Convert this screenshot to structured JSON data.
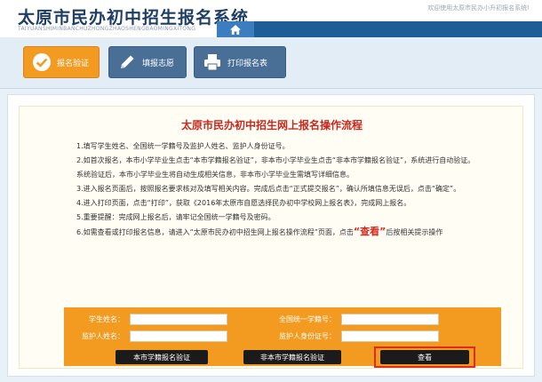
{
  "header": {
    "title": "太原市民办初中招生报名系统",
    "subtitle": "TAIYUANSHIMINBANCHUZHONGZHAOSHENGBAOMINGXITONG",
    "welcome": "欢迎使用太原市民办小升初报名系统!",
    "home_icon": "home-icon"
  },
  "toolbar": {
    "verify_label": "报名验证",
    "view_label": "填报志愿",
    "print_label": "打印报名表"
  },
  "content": {
    "title": "太原市民办初中招生网上报名操作流程",
    "steps": [
      "1.填写学生姓名、全国统一学籍号及监护人姓名、监护人身份证号。",
      "2.如首次报名，本市小学毕业生点击“本市学籍报名验证”，非本市小学毕业生点击“非本市学籍报名验证”，系统进行自动验证。",
      "系统验证后，本市小学毕业生将自动生成相关信息，非本市小学毕业生需填写详细信息。",
      "3.进入报名页面后，按照报名要求核对及填写相关内容。完成后点击“正式提交报名”，确认所填信息无误后，点击“确定”。",
      "4.进入打印页面，点击“打印”，获取《2016年太原市自愿选择民办初中学校网上报名表》，完成网上报名。",
      "5.重要提醒：完成网上报名后，请牢记全国统一学籍号及密码。"
    ],
    "step6_before": "6.如需查看或打印报名信息，请进入“太原市民办初中招生网上报名操作流程”页面，点击",
    "step6_highlight": "“查看”",
    "step6_after": "后按相关提示操作"
  },
  "form": {
    "student_name_label": "学生姓名：",
    "student_id_label": "全国统一学籍号：",
    "guardian_name_label": "监护人姓名：",
    "guardian_id_label": "监护人身份证号：",
    "student_name_value": "",
    "student_id_value": "",
    "guardian_name_value": "",
    "guardian_id_value": "",
    "local_verify_label": "本市学籍报名验证",
    "nonlocal_verify_label": "非本市学籍报名验证",
    "view_button_label": "查看"
  },
  "colors": {
    "accent_orange": "#f29b20",
    "nav_blue": "#1f5d96",
    "title_red": "#c8281e"
  }
}
